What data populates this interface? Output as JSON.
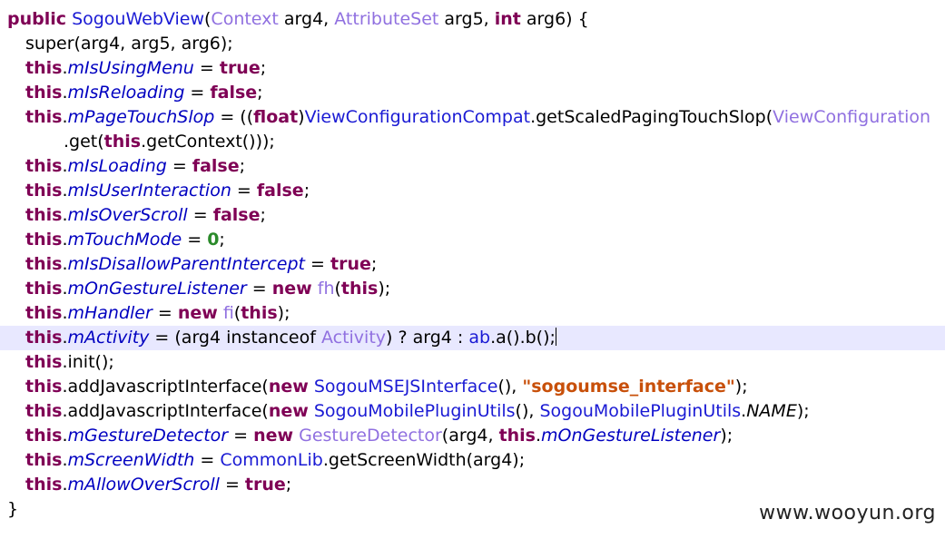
{
  "watermark": "www.wooyun.org",
  "colors": {
    "keyword": "#7f0055",
    "type": "#9070e0",
    "class": "#1a1ad4",
    "field": "#0000c0",
    "number": "#2a8a2a",
    "string": "#c8500a",
    "highlight": "#e8e8ff"
  },
  "code": {
    "l1": [
      "public",
      " ",
      "SogouWebView",
      "(",
      "Context",
      " arg4, ",
      "AttributeSet",
      " arg5, ",
      "int",
      " arg6) {"
    ],
    "l2": [
      "super(arg4, arg5, arg6);"
    ],
    "l3": [
      "this",
      ".",
      "mIsUsingMenu",
      " = ",
      "true",
      ";"
    ],
    "l4": [
      "this",
      ".",
      "mIsReloading",
      " = ",
      "false",
      ";"
    ],
    "l5": [
      "this",
      ".",
      "mPageTouchSlop",
      " = ((",
      "float",
      ")",
      "ViewConfigurationCompat",
      ".getScaledPagingTouchSlop(",
      "ViewConfiguration"
    ],
    "l6": [
      ".get(",
      "this",
      ".getContext()));"
    ],
    "l7": [
      "this",
      ".",
      "mIsLoading",
      " = ",
      "false",
      ";"
    ],
    "l8": [
      "this",
      ".",
      "mIsUserInteraction",
      " = ",
      "false",
      ";"
    ],
    "l9": [
      "this",
      ".",
      "mIsOverScroll",
      " = ",
      "false",
      ";"
    ],
    "l10": [
      "this",
      ".",
      "mTouchMode",
      " = ",
      "0",
      ";"
    ],
    "l11": [
      "this",
      ".",
      "mIsDisallowParentIntercept",
      " = ",
      "true",
      ";"
    ],
    "l12": [
      "this",
      ".",
      "mOnGestureListener",
      " = ",
      "new",
      " ",
      "fh",
      "(",
      "this",
      ");"
    ],
    "l13": [
      "this",
      ".",
      "mHandler",
      " = ",
      "new",
      " ",
      "fi",
      "(",
      "this",
      ");"
    ],
    "l14": [
      "this",
      ".",
      "mActivity",
      " = (arg4 instanceof ",
      "Activity",
      ") ? arg4 : ",
      "ab",
      ".a().b();"
    ],
    "l15": [
      "this",
      ".init();"
    ],
    "l16": [
      "this",
      ".addJavascriptInterface(",
      "new",
      " ",
      "SogouMSEJSInterface",
      "(), ",
      "\"sogoumse_interface\"",
      ");"
    ],
    "l17": [
      "this",
      ".addJavascriptInterface(",
      "new",
      " ",
      "SogouMobilePluginUtils",
      "(), ",
      "SogouMobilePluginUtils",
      ".",
      "NAME",
      ");"
    ],
    "l18": [
      "this",
      ".",
      "mGestureDetector",
      " = ",
      "new",
      " ",
      "GestureDetector",
      "(arg4, ",
      "this",
      ".",
      "mOnGestureListener",
      ");"
    ],
    "l19": [
      "this",
      ".",
      "mScreenWidth",
      " = ",
      "CommonLib",
      ".getScreenWidth(arg4);"
    ],
    "l20": [
      "this",
      ".",
      "mAllowOverScroll",
      " = ",
      "true",
      ";"
    ],
    "l21": [
      "}"
    ]
  }
}
